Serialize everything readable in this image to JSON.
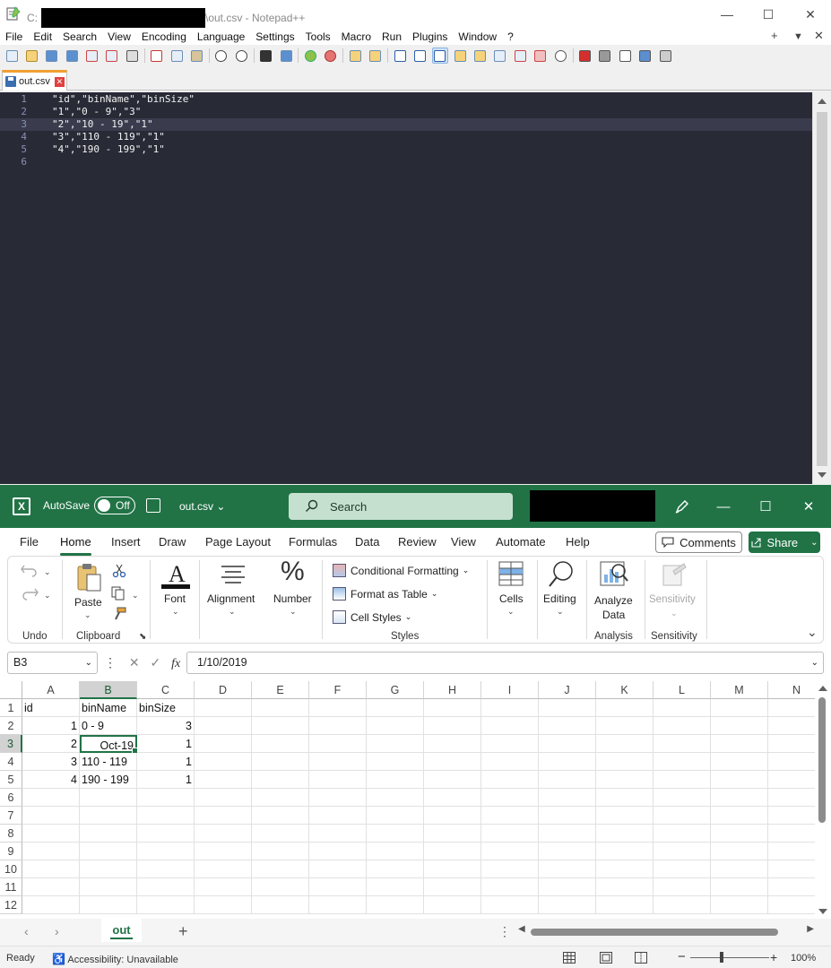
{
  "notepad": {
    "title_prefix": "C:",
    "title_suffix": "\\out.csv - Notepad++",
    "menu": [
      "File",
      "Edit",
      "Search",
      "View",
      "Encoding",
      "Language",
      "Settings",
      "Tools",
      "Macro",
      "Run",
      "Plugins",
      "Window",
      "?"
    ],
    "menu_right": [
      "+",
      "▼",
      "✕"
    ],
    "tab_label": "out.csv",
    "lines": [
      {
        "num": "1",
        "text": "\"id\",\"binName\",\"binSize\""
      },
      {
        "num": "2",
        "text": "\"1\",\"0 - 9\",\"3\""
      },
      {
        "num": "3",
        "text": "\"2\",\"10 - 19\",\"1\""
      },
      {
        "num": "4",
        "text": "\"3\",\"110 - 119\",\"1\""
      },
      {
        "num": "5",
        "text": "\"4\",\"190 - 199\",\"1\""
      },
      {
        "num": "6",
        "text": ""
      }
    ],
    "current_line": 3,
    "theme": {
      "editor_bg": "#282a36",
      "line_number": "#8b8fb5",
      "text": "#f2f2f2"
    }
  },
  "excel": {
    "autosave_label": "AutoSave",
    "autosave_state": "Off",
    "file_name": "out.csv",
    "search_placeholder": "Search",
    "tabs": [
      "File",
      "Home",
      "Insert",
      "Draw",
      "Page Layout",
      "Formulas",
      "Data",
      "Review",
      "View",
      "Automate",
      "Help"
    ],
    "active_tab": "Home",
    "comments_label": "Comments",
    "share_label": "Share",
    "ribbon": {
      "undo_group": "Undo",
      "clipboard_group": "Clipboard",
      "paste_label": "Paste",
      "font_label": "Font",
      "alignment_label": "Alignment",
      "number_label": "Number",
      "conditional_formatting": "Conditional Formatting",
      "format_as_table": "Format as Table",
      "cell_styles": "Cell Styles",
      "styles_group": "Styles",
      "cells_label": "Cells",
      "editing_label": "Editing",
      "analyze_data_line1": "Analyze",
      "analyze_data_line2": "Data",
      "analysis_group": "Analysis",
      "sensitivity_label": "Sensitivity",
      "sensitivity_group": "Sensitivity"
    },
    "name_box": "B3",
    "formula_value": "1/10/2019",
    "columns": [
      "A",
      "B",
      "C",
      "D",
      "E",
      "F",
      "G",
      "H",
      "I",
      "J",
      "K",
      "L",
      "M",
      "N"
    ],
    "rows": [
      "1",
      "2",
      "3",
      "4",
      "5",
      "6",
      "7",
      "8",
      "9",
      "10",
      "11",
      "12"
    ],
    "cells": [
      [
        "id",
        "binName",
        "binSize"
      ],
      [
        "1",
        "0 - 9",
        "3"
      ],
      [
        "2",
        "Oct-19",
        "1"
      ],
      [
        "3",
        "110 - 119",
        "1"
      ],
      [
        "4",
        "190 - 199",
        "1"
      ]
    ],
    "active_cell": "B3",
    "sheet_tab": "out",
    "status_ready": "Ready",
    "status_accessibility": "Accessibility: Unavailable",
    "zoom": "100%",
    "accent_color": "#217346"
  }
}
